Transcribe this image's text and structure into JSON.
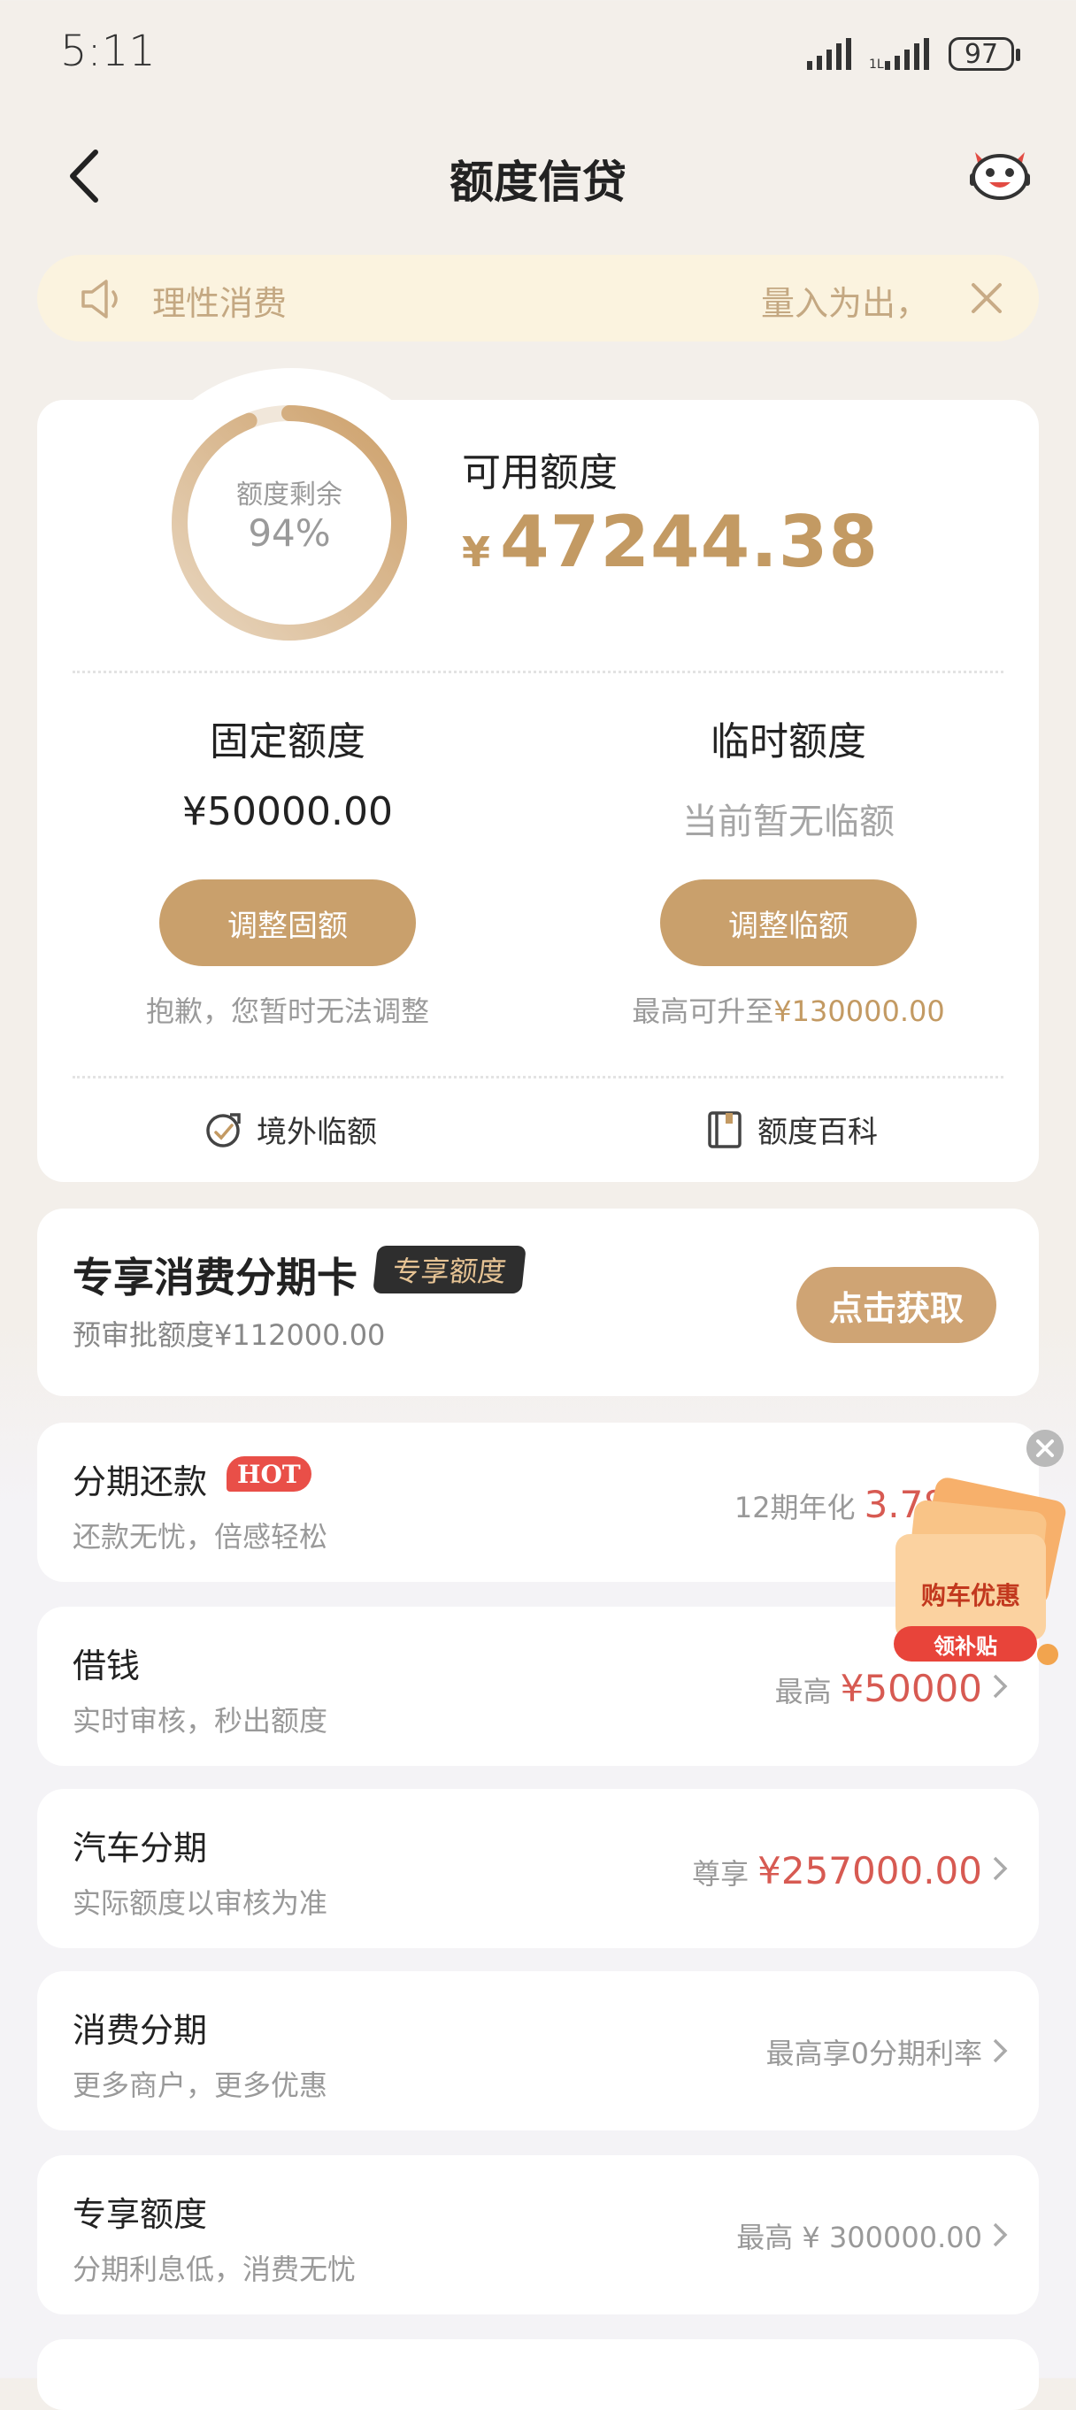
{
  "status_bar": {
    "time": "5:11",
    "battery": "97"
  },
  "header": {
    "title": "额度信贷"
  },
  "notice": {
    "text_left": "理性消费",
    "text_right": "量入为出，"
  },
  "credit_card": {
    "ring_label": "额度剩余",
    "ring_percent": "94%",
    "ring_fraction": 0.94,
    "available_label": "可用额度",
    "available_currency": "¥",
    "available_amount": "47244.38",
    "fixed": {
      "title": "固定额度",
      "value": "¥50000.00",
      "button": "调整固额",
      "note": "抱歉，您暂时无法调整"
    },
    "temporary": {
      "title": "临时额度",
      "value": "当前暂无临额",
      "button": "调整临额",
      "note_prefix": "最高可升至",
      "note_amount": "¥130000.00"
    },
    "links": [
      {
        "label": "境外临额",
        "icon": "overseas-icon"
      },
      {
        "label": "额度百科",
        "icon": "book-icon"
      }
    ]
  },
  "installment_card": {
    "title": "专享消费分期卡",
    "badge": "专享额度",
    "subtitle": "预审批额度¥112000.00",
    "button": "点击获取"
  },
  "rows": [
    {
      "title": "分期还款",
      "badge": "HOT",
      "subtitle": "还款无忧，倍感轻松",
      "right_prefix": "12期年化",
      "right_value": "3.78%"
    },
    {
      "title": "借钱",
      "subtitle": "实时审核，秒出额度",
      "right_prefix": "最高",
      "right_value": "¥50000"
    },
    {
      "title": "汽车分期",
      "subtitle": "实际额度以审核为准",
      "right_prefix": "尊享",
      "right_value": "¥257000.00"
    },
    {
      "title": "消费分期",
      "subtitle": "更多商户，更多优惠",
      "right_prefix": "最高享0分期利率",
      "right_value": ""
    },
    {
      "title": "专享额度",
      "subtitle": "分期利息低，消费无忧",
      "right_prefix": "最高 ¥ 300000.00",
      "right_value": ""
    }
  ],
  "promo": {
    "title": "购车优惠",
    "button": "领补贴"
  },
  "colors": {
    "gold": "#c9a06c",
    "red": "#d75a52",
    "notice_bg": "#fbf3df"
  }
}
